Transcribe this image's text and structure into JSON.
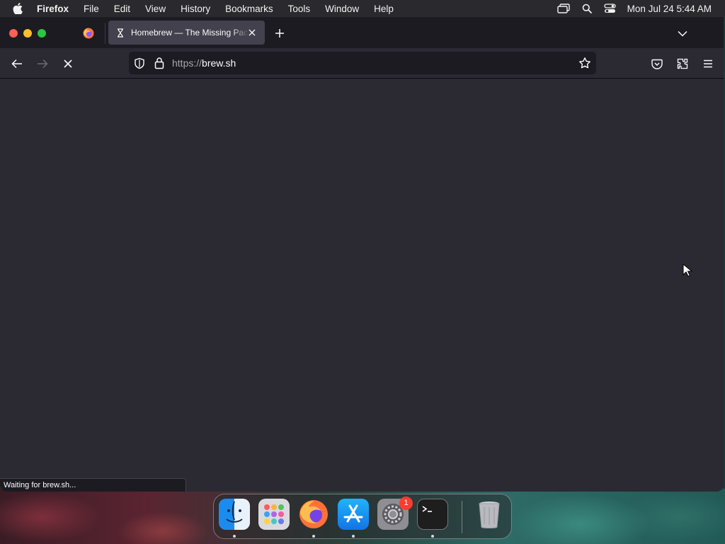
{
  "menubar": {
    "app_name": "Firefox",
    "items": [
      "File",
      "Edit",
      "View",
      "History",
      "Bookmarks",
      "Tools",
      "Window",
      "Help"
    ],
    "clock": "Mon Jul 24  5:44 AM"
  },
  "tabs": [
    {
      "title": "Homebrew — The Missing Package Manager for macOS (or Linux)",
      "active": true,
      "loading": true
    }
  ],
  "navbar": {
    "url_scheme": "https://",
    "url_host": "brew.sh"
  },
  "status_text": "Waiting for brew.sh...",
  "dock": {
    "apps": [
      "Finder",
      "Launchpad",
      "Firefox",
      "App Store",
      "System Settings",
      "Terminal",
      "Trash"
    ],
    "settings_badge": "1"
  },
  "colors": {
    "toolbar": "#2b2a33",
    "tabbar": "#1c1b22",
    "active_tab": "#42414d",
    "close": "#fe5f57",
    "minimize": "#febc2e",
    "maximize": "#28c840"
  }
}
